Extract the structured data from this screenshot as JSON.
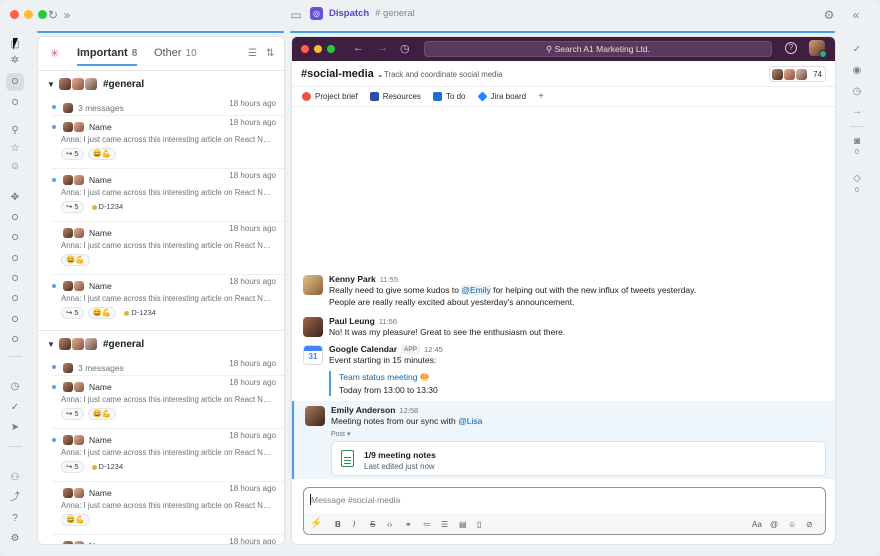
{
  "titlebar": {
    "app_name": "Dispatch",
    "channel_crumb": "# general"
  },
  "inbox": {
    "tabs": [
      {
        "label": "Important",
        "count": "8"
      },
      {
        "label": "Other",
        "count": "10"
      }
    ],
    "groups": [
      {
        "name": "#general",
        "items": [
          {
            "who": "3 messages",
            "time": "18 hours ago",
            "preview": "",
            "chips": []
          },
          {
            "who": "Name",
            "time": "18 hours ago",
            "preview": "Anna: I just came across this interesting article on React Native",
            "chips": [
              "↪ 5",
              "😄💪"
            ]
          },
          {
            "who": "Name",
            "time": "18 hours ago",
            "preview": "Anna: I just came across this interesting article on React Native",
            "chips": [
              "↪ 5",
              "D-1234"
            ]
          },
          {
            "who": "Name",
            "time": "18 hours ago",
            "preview": "Anna: I just came across this interesting article on React Native",
            "chips": [
              "😄💪"
            ]
          },
          {
            "who": "Name",
            "time": "18 hours ago",
            "preview": "Anna: I just came across this interesting article on React Native",
            "chips": [
              "↪ 5",
              "😄💪",
              "D-1234"
            ]
          }
        ]
      },
      {
        "name": "#general",
        "items": [
          {
            "who": "3 messages",
            "time": "18 hours ago",
            "preview": "",
            "chips": []
          },
          {
            "who": "Name",
            "time": "18 hours ago",
            "preview": "Anna: I just came across this interesting article on React Native",
            "chips": [
              "↪ 5",
              "😄💪"
            ]
          },
          {
            "who": "Name",
            "time": "18 hours ago",
            "preview": "Anna: I just came across this interesting article on React Native",
            "chips": [
              "↪ 5",
              "D-1234"
            ]
          },
          {
            "who": "Name",
            "time": "18 hours ago",
            "preview": "Anna: I just came across this interesting article on React Native",
            "chips": [
              "😄💪"
            ]
          },
          {
            "who": "Name",
            "time": "18 hours ago",
            "preview": "",
            "chips": []
          }
        ]
      }
    ]
  },
  "chat": {
    "search_placeholder": "Search A1 Marketing Ltd.",
    "channel_name": "#social-media",
    "channel_desc": "Track and coordinate social media",
    "member_count": "74",
    "bookmarks": [
      "Project brief",
      "Resources",
      "To do",
      "Jira board"
    ],
    "messages": [
      {
        "author": "Kenny Park",
        "time": "11:55",
        "pre": "Really need to give some kudos to ",
        "mention": "@Emily",
        "post": " for helping out with the new influx of tweets yesterday.",
        "line2": "People are really really excited about yesterday's announcement."
      },
      {
        "author": "Paul Leung",
        "time": "11:56",
        "text": "No! It was my pleasure! Great to see the enthusiasm out there."
      },
      {
        "author": "Google Calendar",
        "badge": "APP",
        "time": "12:45",
        "text": "Event starting in 15 minutes:",
        "event_title": "Team status meeting",
        "event_time": "Today from 13:00 to 13:30"
      },
      {
        "author": "Emily Anderson",
        "time": "12:58",
        "pre": "Meeting notes from our sync with ",
        "mention": "@Lisa",
        "post_label": "Post ▾",
        "card_title": "1/9 meeting notes",
        "card_sub": "Last edited just now"
      }
    ],
    "composer_placeholder": "Message #social-media"
  },
  "right_rail": {
    "counts": [
      "0",
      "0"
    ]
  },
  "colors": {
    "accent": "#4e9be6",
    "workspace_bar": "#3f1f3f",
    "mention": "#1264a3",
    "brand": "#6b4fd8"
  }
}
